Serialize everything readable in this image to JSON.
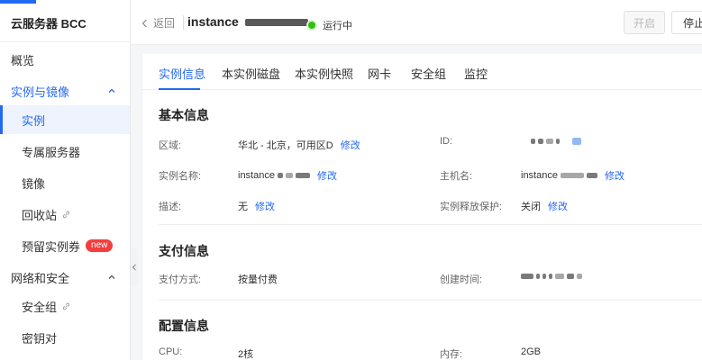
{
  "sidebar": {
    "brand": "云服务器 BCC",
    "items": {
      "overview": "概览",
      "instances_group": "实例与镜像",
      "instances": "实例",
      "dedicated": "专属服务器",
      "images": "镜像",
      "recycle": "回收站",
      "reserved": "预留实例券",
      "reserved_badge": "new",
      "network_group": "网络和安全",
      "security_group": "安全组",
      "keypair": "密钥对"
    }
  },
  "header": {
    "back": "返回",
    "instance_title": "instance",
    "status": "运行中",
    "start_btn": "开启",
    "stop_btn": "停止"
  },
  "tabs": [
    "实例信息",
    "本实例磁盘",
    "本实例快照",
    "网卡",
    "安全组",
    "监控"
  ],
  "basic": {
    "title": "基本信息",
    "region_label": "区域:",
    "region_value": "华北 - 北京，可用区D",
    "region_edit": "修改",
    "id_label": "ID:",
    "name_label": "实例名称:",
    "name_value": "instance",
    "name_edit": "修改",
    "host_label": "主机名:",
    "host_value": "instance",
    "host_edit": "修改",
    "desc_label": "描述:",
    "desc_value": "无",
    "desc_edit": "修改",
    "release_label": "实例释放保护:",
    "release_value": "关闭",
    "release_edit": "修改"
  },
  "payment": {
    "title": "支付信息",
    "method_label": "支付方式:",
    "method_value": "按量付费",
    "created_label": "创建时间:"
  },
  "config": {
    "title": "配置信息",
    "cpu_label": "CPU:",
    "cpu_value": "2核",
    "mem_label": "内存:",
    "mem_value": "2GB"
  },
  "colors": {
    "accent": "#2468f2",
    "running": "#30bf13",
    "badge": "#f33e3e"
  }
}
